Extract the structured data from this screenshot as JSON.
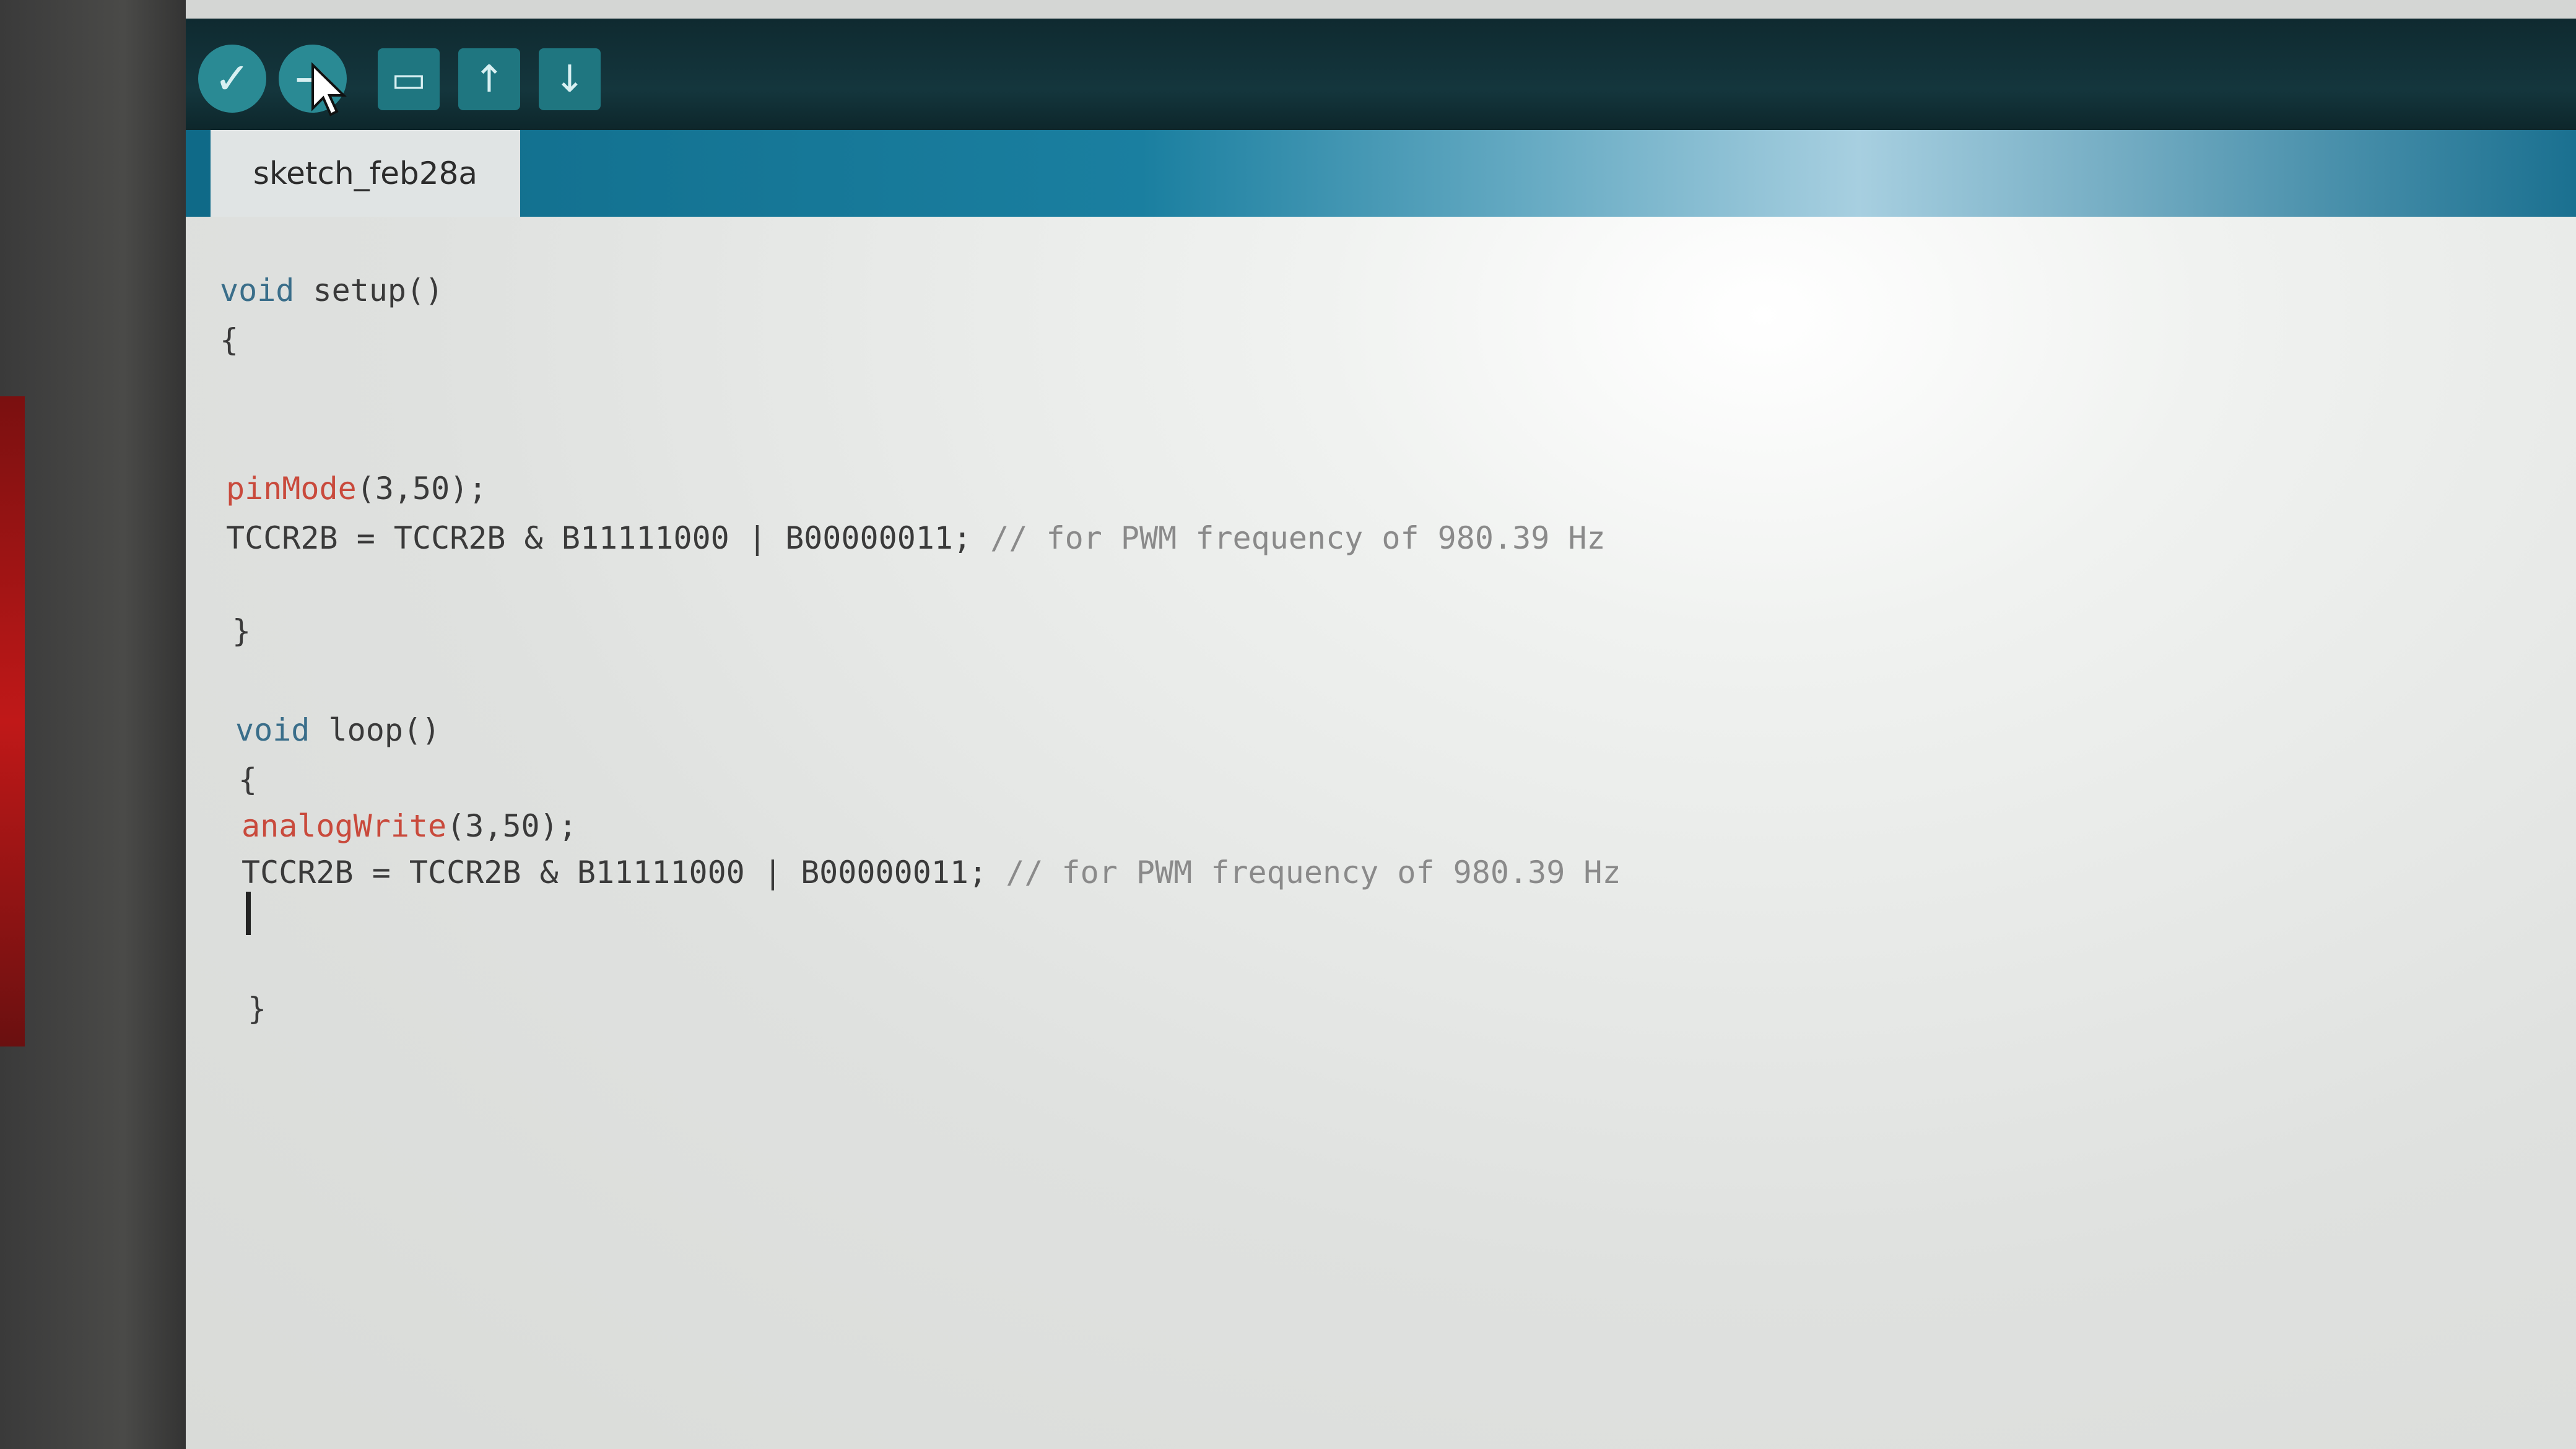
{
  "toolbar": {
    "buttons": [
      {
        "name": "verify",
        "glyph": "✓"
      },
      {
        "name": "upload",
        "glyph": "→"
      },
      {
        "name": "new",
        "glyph": "▭"
      },
      {
        "name": "open",
        "glyph": "↑"
      },
      {
        "name": "save",
        "glyph": "↓"
      }
    ]
  },
  "tab": {
    "label": "sketch_feb28a"
  },
  "code": {
    "line1_kw": "void",
    "line1_rest": " setup()",
    "line2": "{",
    "line3_fn": "pinMode",
    "line3_rest": "(3,50);",
    "line4_code": "TCCR2B = TCCR2B & B11111000 | B00000011; ",
    "line4_comment": "// for PWM frequency of 980.39 Hz",
    "line5": "}",
    "line6_kw": "void",
    "line6_rest": " loop()",
    "line7": "{",
    "line8_fn": "analogWrite",
    "line8_rest": "(3,50);",
    "line9_code": "TCCR2B = TCCR2B & B11111000 | B00000011; ",
    "line9_comment": "// for PWM frequency of 980.39 Hz",
    "line10": "}"
  },
  "colors": {
    "toolbar_bg": "#14363d",
    "button_teal": "#2a8a94",
    "tab_bar": "#1a7fa0",
    "keyword": "#3a6e8a",
    "function": "#c94a3c",
    "comment": "#8a8a8a"
  }
}
